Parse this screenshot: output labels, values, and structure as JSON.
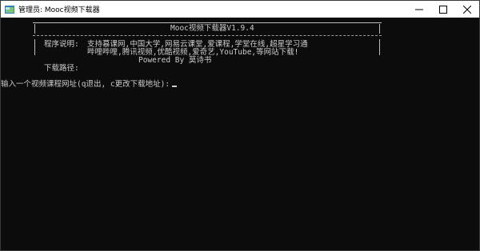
{
  "window": {
    "title": "管理员:  Mooc视频下载器"
  },
  "banner": {
    "title": "Mooc视频下载器V1.9.4",
    "desc_label": "程序说明:",
    "desc_line1": "支持慕课网,中国大学,网易云课堂,爱课程,学堂在线,超星学习通",
    "desc_line2": "哔哩哔哩,腾讯视频,优酷视频,爱奇艺,YouTube,等网站下载!",
    "powered": "Powered By 莫诗书",
    "download_path_label": "下载路径:"
  },
  "prompt": {
    "text": "输入一个视频课程网址(q退出, c更改下载地址):"
  },
  "colors": {
    "console_bg": "#0c0c0c",
    "console_text": "#cccccc",
    "titlebar_bg": "#ffffff"
  }
}
